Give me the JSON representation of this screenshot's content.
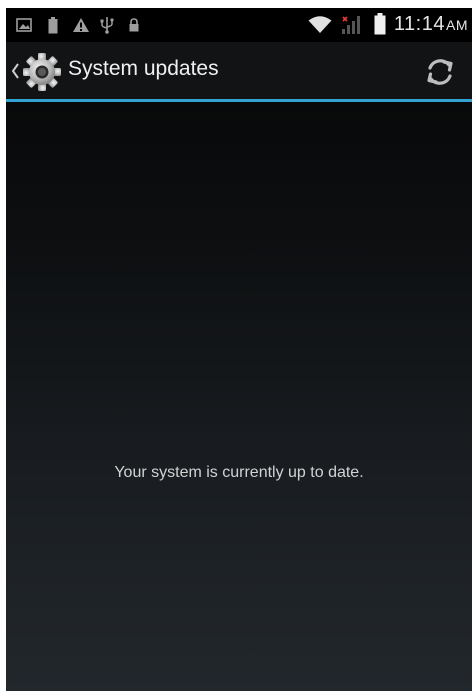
{
  "status_bar": {
    "time": "11:14",
    "ampm": "AM",
    "left_icons": [
      "image-icon",
      "battery-small-icon",
      "warning-icon",
      "usb-icon",
      "lock-icon"
    ],
    "right_icons": [
      "wifi-icon",
      "no-signal-icon",
      "battery-icon"
    ]
  },
  "action_bar": {
    "title": "System updates",
    "accent_color": "#33a3d4"
  },
  "main": {
    "message": "Your system is currently up to date."
  }
}
